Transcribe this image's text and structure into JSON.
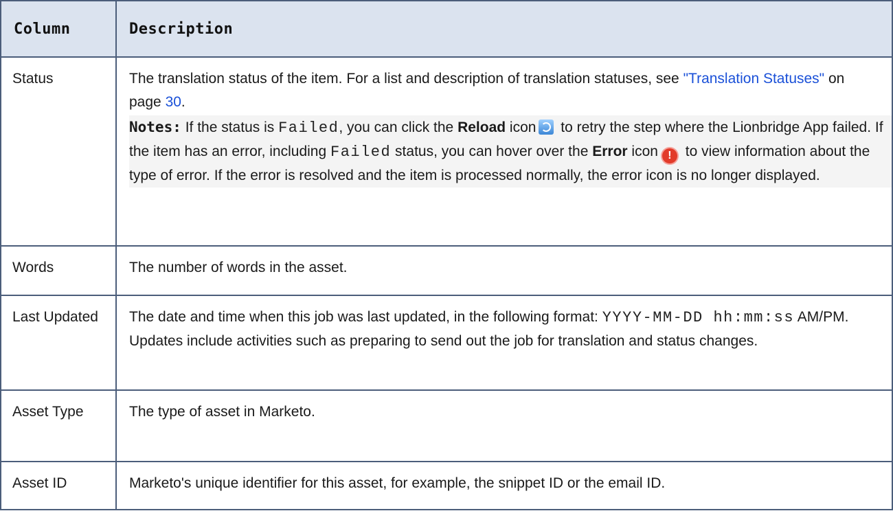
{
  "header": {
    "col1": "Column",
    "col2": "Description"
  },
  "rows": [
    {
      "name": "Status",
      "desc_pre": "The translation status of the item. For a list and description of translation statuses, see ",
      "link_text": "\"Translation Statuses\"",
      "link_mid": " on page ",
      "page_num": "30",
      "desc_end": ".",
      "note": {
        "label": "Notes:",
        "t1": " If the status is ",
        "failed1": "Failed",
        "t2": ", you can click the ",
        "reload_bold": "Reload",
        "t3": " icon",
        "reload_icon": "reload-icon",
        "t4": " to retry the step where the Lionbridge App failed. If the item has an error, including ",
        "failed2": "Failed",
        "t5": " status, you can hover over the ",
        "error_bold": "Error",
        "t6": " icon",
        "error_icon": "error-icon",
        "t7": " to view information about the type of error. If the error is resolved and the item is processed normally, the error icon is no longer displayed."
      }
    },
    {
      "name": "Words",
      "desc": "The number of words in the asset."
    },
    {
      "name": "Last Updated",
      "d1": "The date and time when this job was last updated, in the following format: ",
      "fmt": "YYYY-MM-DD hh:mm:ss",
      "d2": " AM/PM. Updates include activities such as preparing to send out the job for translation and status changes."
    },
    {
      "name": "Asset Type",
      "desc": "The type of asset in Marketo."
    },
    {
      "name": "Asset ID",
      "desc": "Marketo's unique identifier for this asset, for example, the snippet ID or the email ID."
    }
  ],
  "colors": {
    "header_bg": "#dbe3ef",
    "border": "#4b5d7a",
    "link": "#1a50d8",
    "note_bg": "#f4f4f4"
  }
}
